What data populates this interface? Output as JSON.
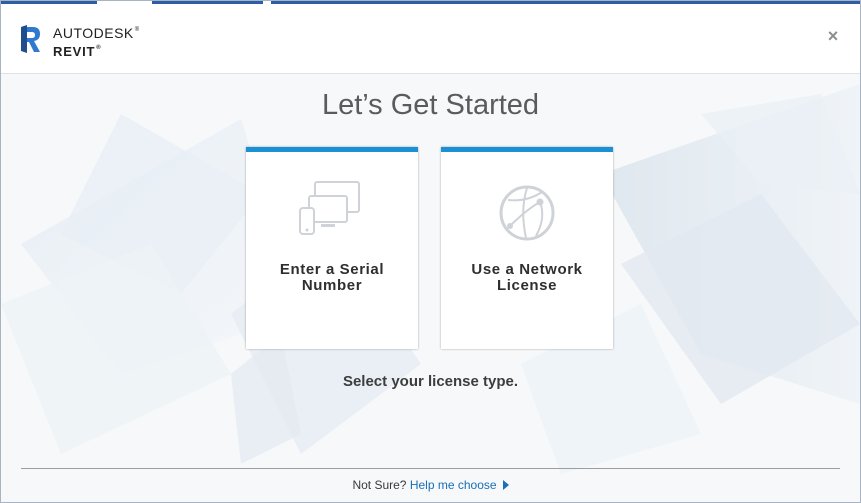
{
  "header": {
    "brand_line1": "AUTODESK",
    "brand_line2": "REVIT",
    "close_glyph": "×"
  },
  "title": "Let’s Get Started",
  "cards": [
    {
      "label": "Enter a Serial Number",
      "icon": "devices-icon"
    },
    {
      "label": "Use a Network License",
      "icon": "network-globe-icon"
    }
  ],
  "hint": "Select your license type.",
  "footer": {
    "prefix": "Not Sure?",
    "link": "Help me choose"
  },
  "colors": {
    "accent": "#1b91d3",
    "link": "#1a6fb5",
    "top_strip": "#2b5ea7"
  }
}
